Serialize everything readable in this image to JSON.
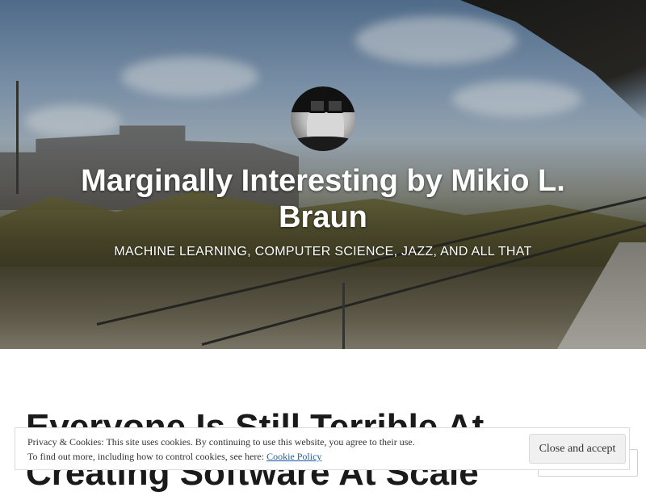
{
  "site": {
    "title": "Marginally Interesting by Mikio L. Braun",
    "tagline": "MACHINE LEARNING, COMPUTER SCIENCE, JAZZ, AND ALL THAT"
  },
  "post": {
    "title": "Everyone Is Still Terrible At Creating Software At Scale"
  },
  "cookie_banner": {
    "line1": "Privacy & Cookies: This site uses cookies. By continuing to use this website, you agree to their use.",
    "line2": "To find out more, including how to control cookies, see here:",
    "link_label": "Cookie Policy",
    "button_label": "Close and accept"
  },
  "colors": {
    "title_text": "#ffffff",
    "post_title": "#1a1a1a",
    "link": "#1a5da8"
  }
}
